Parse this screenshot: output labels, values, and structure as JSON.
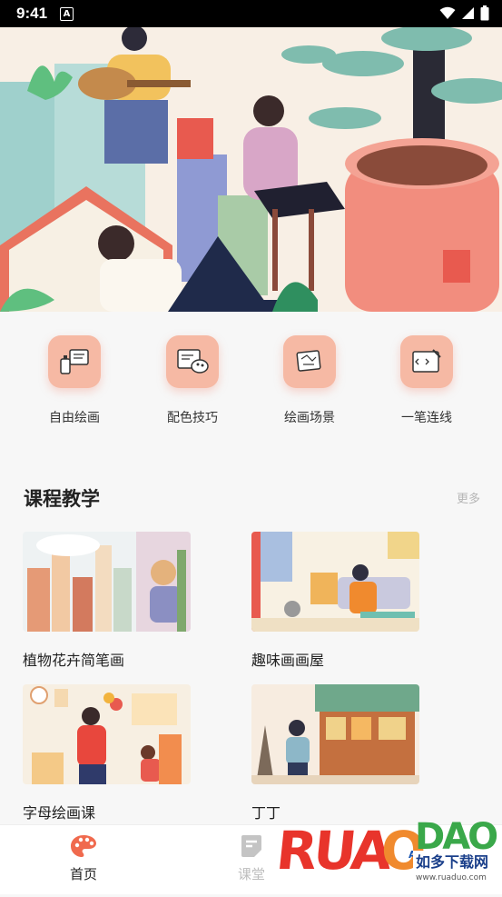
{
  "status_bar": {
    "time": "9:41",
    "badge": "A"
  },
  "quick_actions": [
    {
      "label": "自由绘画",
      "icon": "spray-paint-icon"
    },
    {
      "label": "配色技巧",
      "icon": "palette-board-icon"
    },
    {
      "label": "绘画场景",
      "icon": "easel-icon"
    },
    {
      "label": "一笔连线",
      "icon": "code-pen-icon"
    }
  ],
  "section": {
    "title": "课程教学",
    "more": "更多"
  },
  "courses": [
    {
      "title": "植物花卉简笔画"
    },
    {
      "title": "趣味画画屋"
    },
    {
      "title": "字母绘画课"
    },
    {
      "title": "丁丁"
    }
  ],
  "tabs": [
    {
      "label": "首页",
      "icon": "palette-icon",
      "active": true
    },
    {
      "label": "课堂",
      "icon": "note-icon",
      "active": false
    }
  ],
  "watermark": {
    "brand": "RUANDAO",
    "text": "如多下载网",
    "url": "www.ruaduo.com"
  },
  "colors": {
    "accent": "#f06a4e",
    "icon_bg": "#f6b9a4",
    "inactive": "#bdbdbd"
  }
}
